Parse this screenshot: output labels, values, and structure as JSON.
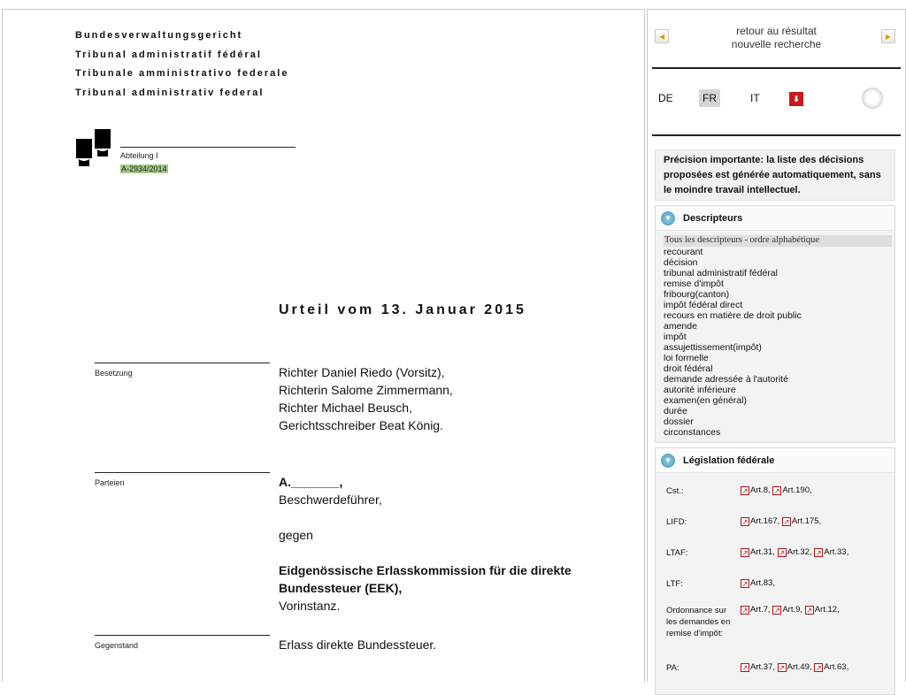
{
  "court": {
    "names": [
      "Bundesverwaltungsgericht",
      "Tribunal administratif fédéral",
      "Tribunale amministrativo federale",
      "Tribunal administrativ federal"
    ],
    "division": "Abteilung I",
    "case_number": "A-2934/2014"
  },
  "judgment": {
    "title": "Urteil vom 13. Januar 2015",
    "besetzung_label": "Besetzung",
    "besetzung": [
      "Richter Daniel Riedo (Vorsitz),",
      "Richterin Salome Zimmermann,",
      "Richter Michael Beusch,",
      "Gerichtsschreiber Beat König."
    ],
    "parteien_label": "Parteien",
    "party_a": "A._______,",
    "party_a_role": "Beschwerdeführer,",
    "gegen": "gegen",
    "authority": "Eidgenössische Erlasskommission für die direkte Bundessteuer (EEK),",
    "authority_role": "Vorinstanz.",
    "gegenstand_label": "Gegenstand",
    "gegenstand": "Erlass direkte Bundessteuer."
  },
  "sidebar": {
    "back_link": "retour au résultat",
    "new_search_link": "nouvelle recherche",
    "languages": [
      "DE",
      "FR",
      "IT"
    ],
    "active_language": "FR",
    "pdf_icon": "pdf-icon",
    "notice": "Précision importante: la liste des décisions proposées est générée automatiquement, sans le moindre travail intellectuel.",
    "descripteurs": {
      "title": "Descripteurs",
      "all_link": "Tous les descripteurs - ordre alphabétique",
      "items": [
        "recourant",
        "décision",
        "tribunal administratif fédéral",
        "remise d'impôt",
        "fribourg(canton)",
        "impôt fédéral direct",
        "recours en matière de droit public",
        "amende",
        "impôt",
        "assujettissement(impôt)",
        "loi formelle",
        "droit fédéral",
        "demande adressée à l'autorité",
        "autorité inférieure",
        "examen(en général)",
        "durée",
        "dossier",
        "circonstances"
      ]
    },
    "legislation": {
      "title": "Législation fédérale",
      "rows": [
        {
          "name": "Cst.:",
          "arts": [
            "Art.8,",
            "Art.190,"
          ]
        },
        {
          "name": "LIFD:",
          "arts": [
            "Art.167,",
            "Art.175,"
          ]
        },
        {
          "name": "LTAF:",
          "arts": [
            "Art.31,",
            "Art.32,",
            "Art.33,"
          ]
        },
        {
          "name": "LTF:",
          "arts": [
            "Art.83,"
          ]
        },
        {
          "name": "Ordonnance sur les demandes en remise d'impôt:",
          "arts": [
            "Art.7,",
            "Art.9,",
            "Art.12,"
          ]
        },
        {
          "name": "PA:",
          "arts": [
            "Art.37,",
            "Art.49,",
            "Art.63,"
          ]
        }
      ]
    }
  },
  "colors": {
    "highlight": "#a9c98b",
    "pdf_red": "#c8191c",
    "link_icon_red": "#b61418",
    "toggle_blue": "#3b92b7"
  }
}
